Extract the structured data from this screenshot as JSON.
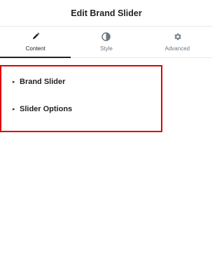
{
  "header": {
    "title": "Edit Brand Slider"
  },
  "tabs": [
    {
      "label": "Content",
      "icon": "pencil-icon",
      "active": true
    },
    {
      "label": "Style",
      "icon": "contrast-icon",
      "active": false
    },
    {
      "label": "Advanced",
      "icon": "gear-icon",
      "active": false
    }
  ],
  "sections": [
    {
      "label": "Brand Slider",
      "caret": "▸"
    },
    {
      "label": "Slider Options",
      "caret": "▸"
    }
  ],
  "colors": {
    "highlight_border": "#e00000",
    "text": "#1f2124",
    "muted": "#6d7882"
  }
}
